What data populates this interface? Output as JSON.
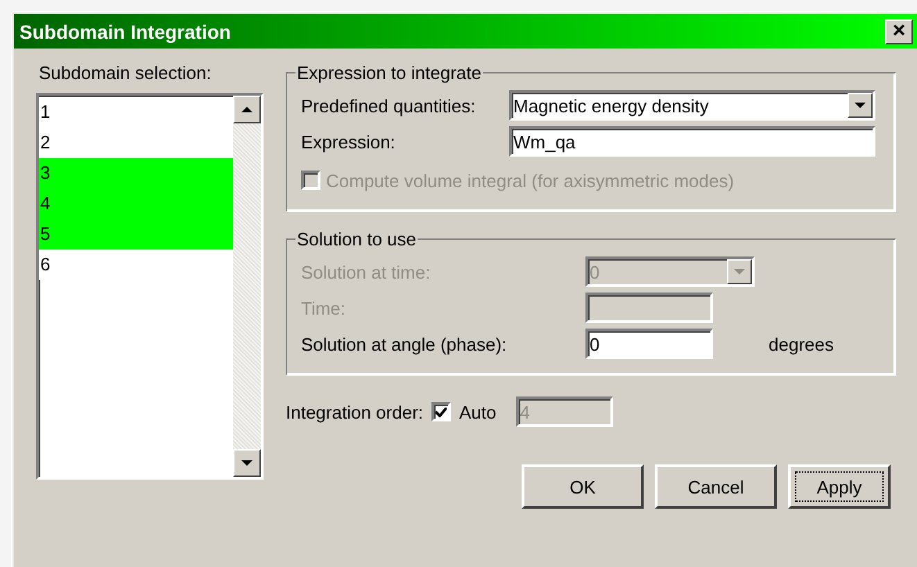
{
  "window": {
    "title": "Subdomain Integration",
    "close": "×"
  },
  "subdomain_selection": {
    "label": "Subdomain selection:",
    "items": [
      {
        "label": "1",
        "selected": false
      },
      {
        "label": "2",
        "selected": false
      },
      {
        "label": "3",
        "selected": true
      },
      {
        "label": "4",
        "selected": true
      },
      {
        "label": "5",
        "selected": true
      },
      {
        "label": "6",
        "selected": false
      }
    ]
  },
  "expression_group": {
    "title": "Expression to integrate",
    "predefined_label": "Predefined quantities:",
    "predefined_value": "Magnetic energy density",
    "expression_label": "Expression:",
    "expression_value": "Wm_qa",
    "volume_integral": {
      "label": "Compute volume integral (for axisymmetric modes)",
      "checked": false,
      "disabled": true
    }
  },
  "solution_group": {
    "title": "Solution to use",
    "rows": [
      {
        "kind": "dropdown",
        "label": "Solution at time:",
        "value": "0",
        "disabled": true
      },
      {
        "kind": "input",
        "label": "Time:",
        "value": "",
        "disabled": true
      },
      {
        "kind": "input",
        "label": "Solution at angle (phase):",
        "value": "0",
        "disabled": false,
        "unit": "degrees"
      }
    ]
  },
  "integration_order": {
    "label": "Integration order:",
    "auto_label": "Auto",
    "auto_checked": true,
    "value": "4",
    "disabled": true
  },
  "buttons": [
    {
      "label": "OK",
      "default": false
    },
    {
      "label": "Cancel",
      "default": false
    },
    {
      "label": "Apply",
      "default": true
    }
  ]
}
